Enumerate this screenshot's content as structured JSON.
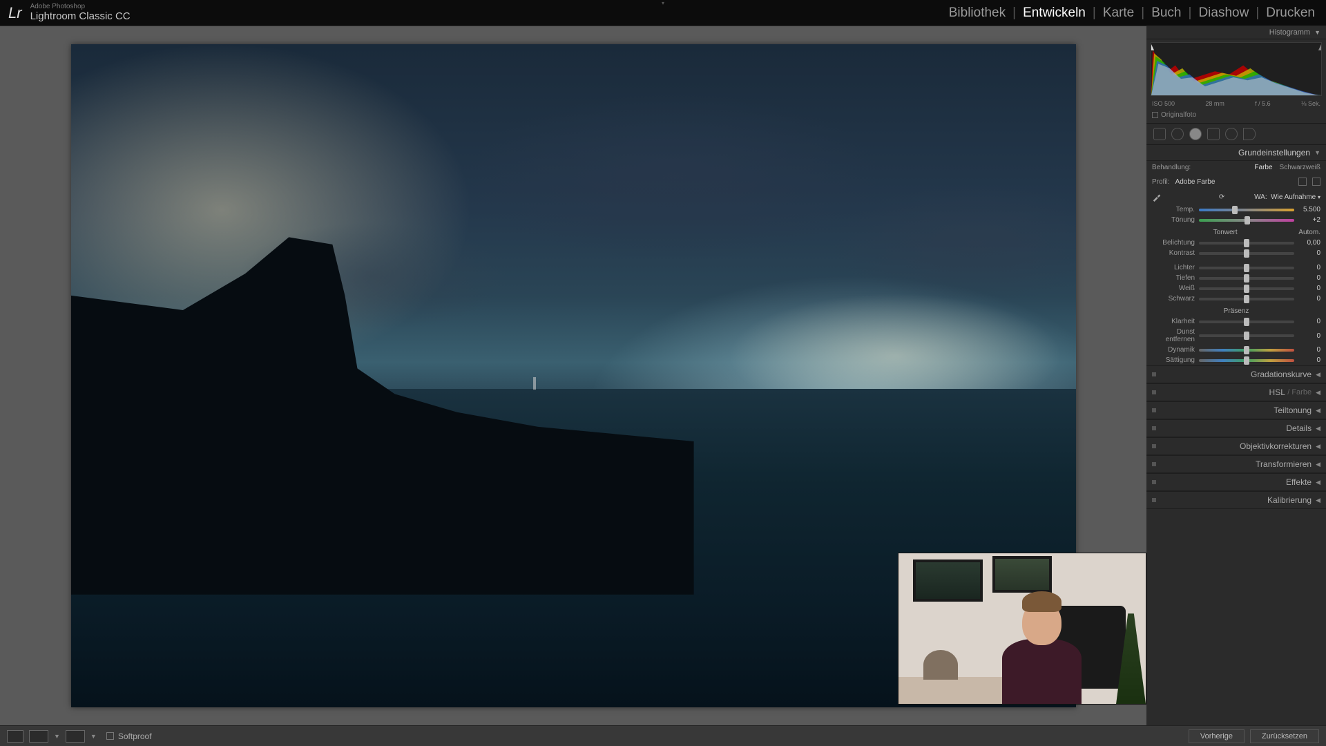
{
  "app": {
    "vendor": "Adobe Photoshop",
    "name": "Lightroom Classic CC"
  },
  "modules": {
    "library": "Bibliothek",
    "develop": "Entwickeln",
    "map": "Karte",
    "book": "Buch",
    "slideshow": "Diashow",
    "print": "Drucken"
  },
  "panels": {
    "histogram_title": "Histogramm",
    "histo_info": {
      "iso": "ISO 500",
      "focal": "28 mm",
      "aperture": "f / 5.6",
      "shutter": "⅛ Sek."
    },
    "originalfoto": "Originalfoto",
    "basic_title": "Grundeinstellungen",
    "treatment": {
      "label": "Behandlung:",
      "color": "Farbe",
      "bw": "Schwarzweiß"
    },
    "profile": {
      "label": "Profil:",
      "value": "Adobe Farbe"
    },
    "whitebalance": {
      "label": "WA:",
      "preset": "Wie Aufnahme"
    },
    "wb_sliders": {
      "temp": {
        "label": "Temp.",
        "value": "5.500"
      },
      "tint": {
        "label": "Tönung",
        "value": "+2"
      }
    },
    "tone": {
      "header": "Tonwert",
      "auto": "Autom.",
      "exposure": {
        "label": "Belichtung",
        "value": "0,00"
      },
      "contrast": {
        "label": "Kontrast",
        "value": "0"
      },
      "highlights": {
        "label": "Lichter",
        "value": "0"
      },
      "shadows": {
        "label": "Tiefen",
        "value": "0"
      },
      "whites": {
        "label": "Weiß",
        "value": "0"
      },
      "blacks": {
        "label": "Schwarz",
        "value": "0"
      }
    },
    "presence": {
      "header": "Präsenz",
      "clarity": {
        "label": "Klarheit",
        "value": "0"
      },
      "dehaze": {
        "label": "Dunst entfernen",
        "value": "0"
      },
      "vibrance": {
        "label": "Dynamik",
        "value": "0"
      },
      "saturation": {
        "label": "Sättigung",
        "value": "0"
      }
    },
    "collapsed": {
      "tonecurve": "Gradationskurve",
      "hsl": "HSL",
      "hsl_sub": "/ Farbe",
      "split": "Teiltonung",
      "detail": "Details",
      "lens": "Objektivkorrekturen",
      "transform": "Transformieren",
      "effects": "Effekte",
      "calibration": "Kalibrierung"
    }
  },
  "footer": {
    "softproof": "Softproof",
    "previous": "Vorherige",
    "reset": "Zurücksetzen"
  }
}
